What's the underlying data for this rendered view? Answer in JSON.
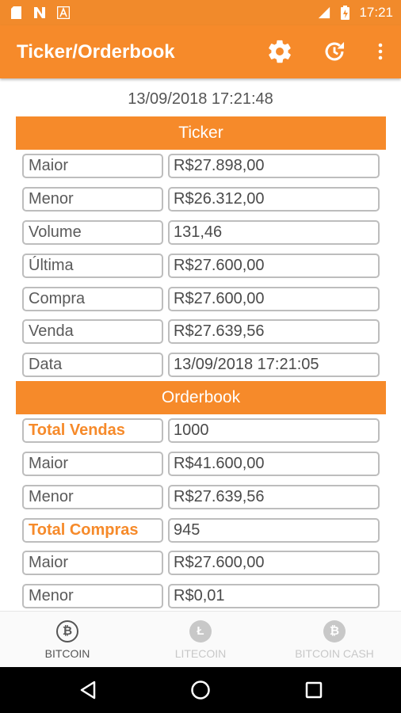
{
  "status_bar": {
    "time": "17:21",
    "left_icons": [
      "file-icon",
      "n-icon",
      "a-icon"
    ],
    "right_icons": [
      "signal-icon",
      "battery-icon"
    ]
  },
  "app_bar": {
    "title": "Ticker/Orderbook",
    "actions": [
      "gear-icon",
      "refresh-icon",
      "more-vert-icon"
    ]
  },
  "timestamp": "13/09/2018 17:21:48",
  "ticker": {
    "header": "Ticker",
    "rows": [
      {
        "label": "Maior",
        "value": "R$27.898,00"
      },
      {
        "label": "Menor",
        "value": "R$26.312,00"
      },
      {
        "label": "Volume",
        "value": "131,46"
      },
      {
        "label": "Última",
        "value": "R$27.600,00"
      },
      {
        "label": "Compra",
        "value": "R$27.600,00"
      },
      {
        "label": "Venda",
        "value": "R$27.639,56"
      },
      {
        "label": "Data",
        "value": "13/09/2018 17:21:05"
      }
    ]
  },
  "orderbook": {
    "header": "Orderbook",
    "rows": [
      {
        "label": "Total Vendas",
        "value": "1000"
      },
      {
        "label": "Maior",
        "value": "R$41.600,00"
      },
      {
        "label": "Menor",
        "value": "R$27.639,56"
      },
      {
        "label": "Total Compras",
        "value": "945"
      },
      {
        "label": "Maior",
        "value": "R$27.600,00"
      },
      {
        "label": "Menor",
        "value": "R$0,01"
      }
    ]
  },
  "bottom_nav": {
    "items": [
      {
        "label": "BITCOIN",
        "icon": "bitcoin-icon",
        "selected": true
      },
      {
        "label": "LITECOIN",
        "icon": "litecoin-icon",
        "selected": false
      },
      {
        "label": "BITCOIN CASH",
        "icon": "bitcoin-cash-icon",
        "selected": false
      }
    ]
  },
  "colors": {
    "accent": "#f68a2a",
    "status_bar": "#f18a2b",
    "border": "#bdbdbd",
    "nav_inactive": "#c8c8c8"
  }
}
